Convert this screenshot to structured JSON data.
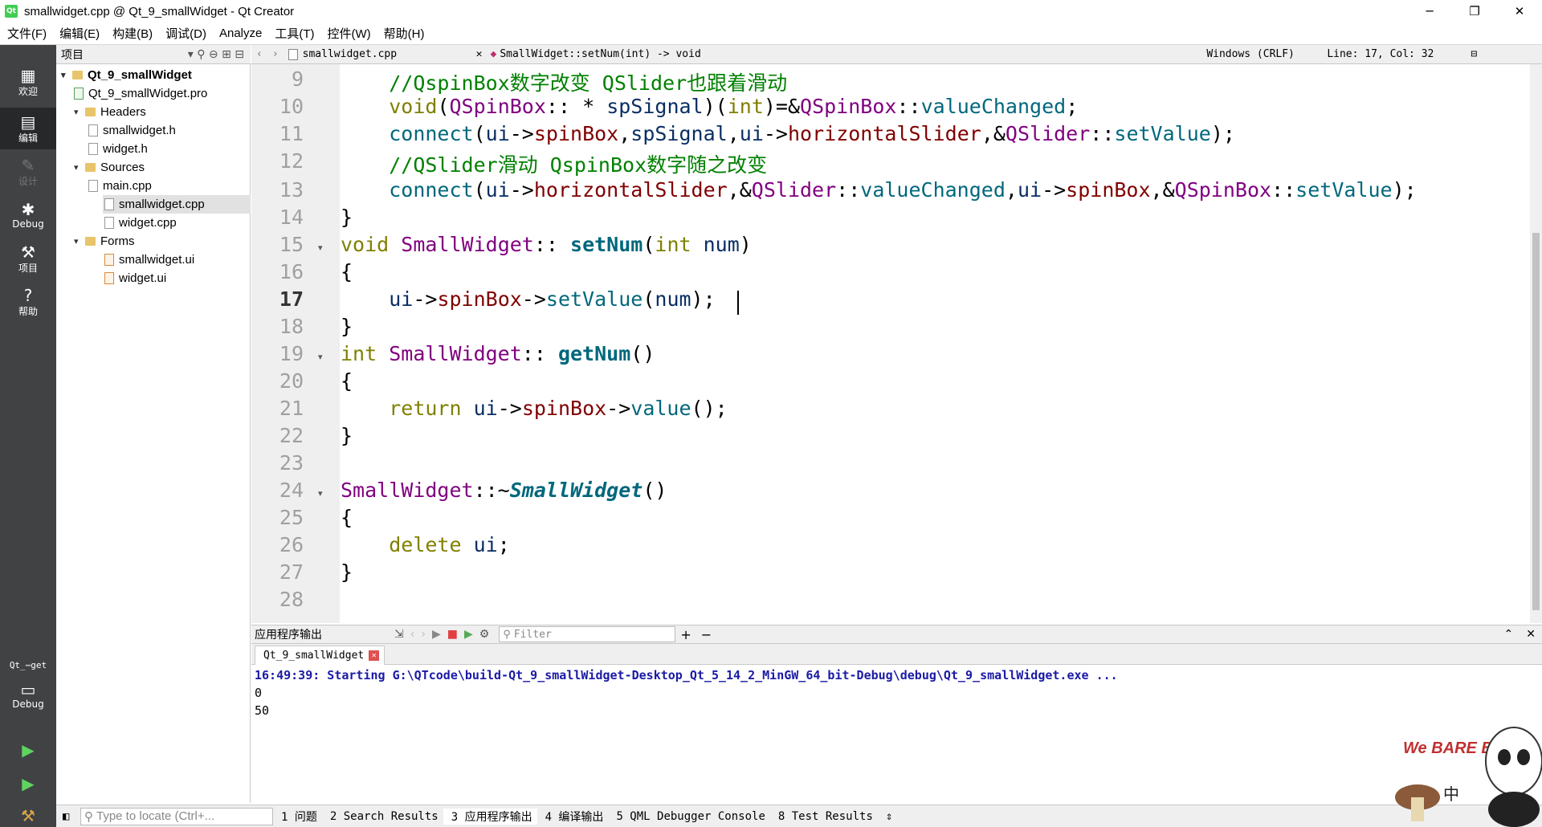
{
  "window": {
    "title": "smallwidget.cpp @ Qt_9_smallWidget - Qt Creator",
    "app_icon": "Qt",
    "controls": [
      "─",
      "❐",
      "✕"
    ]
  },
  "menu": [
    "文件(F)",
    "编辑(E)",
    "构建(B)",
    "调试(D)",
    "Analyze",
    "工具(T)",
    "控件(W)",
    "帮助(H)"
  ],
  "modes": [
    {
      "label": "欢迎",
      "icon": "grid-icon"
    },
    {
      "label": "编辑",
      "icon": "edit-icon"
    },
    {
      "label": "设计",
      "icon": "pencil-icon"
    },
    {
      "label": "Debug",
      "icon": "bug-icon"
    },
    {
      "label": "项目",
      "icon": "wrench-icon"
    },
    {
      "label": "帮助",
      "icon": "help-icon"
    }
  ],
  "kit": {
    "name": "Qt_⋯get",
    "mode": "Debug"
  },
  "project_pane": {
    "title": "项目",
    "tree": {
      "project": "Qt_9_smallWidget",
      "pro_file": "Qt_9_smallWidget.pro",
      "headers_label": "Headers",
      "headers": [
        "smallwidget.h",
        "widget.h"
      ],
      "sources_label": "Sources",
      "sources": [
        "main.cpp",
        "smallwidget.cpp",
        "widget.cpp"
      ],
      "forms_label": "Forms",
      "forms": [
        "smallwidget.ui",
        "widget.ui"
      ]
    }
  },
  "editor_toolbar": {
    "file": "smallwidget.cpp",
    "symbol": "SmallWidget::setNum(int) -> void",
    "line_ending": "Windows (CRLF)",
    "position": "Line: 17, Col: 32"
  },
  "code": {
    "current_line": 17,
    "line_numbers": [
      "9",
      "10",
      "11",
      "12",
      "13",
      "14",
      "15",
      "16",
      "17",
      "18",
      "19",
      "20",
      "21",
      "22",
      "23",
      "24",
      "25",
      "26",
      "27",
      "28"
    ]
  },
  "output": {
    "title": "应用程序输出",
    "filter_placeholder": "Filter",
    "tab": "Qt_9_smallWidget",
    "lines": [
      "16:49:39: Starting G:\\QTcode\\build-Qt_9_smallWidget-Desktop_Qt_5_14_2_MinGW_64_bit-Debug\\debug\\Qt_9_smallWidget.exe ...",
      "0",
      "50"
    ]
  },
  "statusbar": {
    "locator_placeholder": "Type to locate (Ctrl+...",
    "tabs": [
      "1 问题",
      "2 Search Results",
      "3 应用程序输出",
      "4 编译输出",
      "5 QML Debugger Console",
      "8 Test Results"
    ]
  },
  "mascot": {
    "brand": "We BARE BEARS",
    "ime": "中"
  }
}
